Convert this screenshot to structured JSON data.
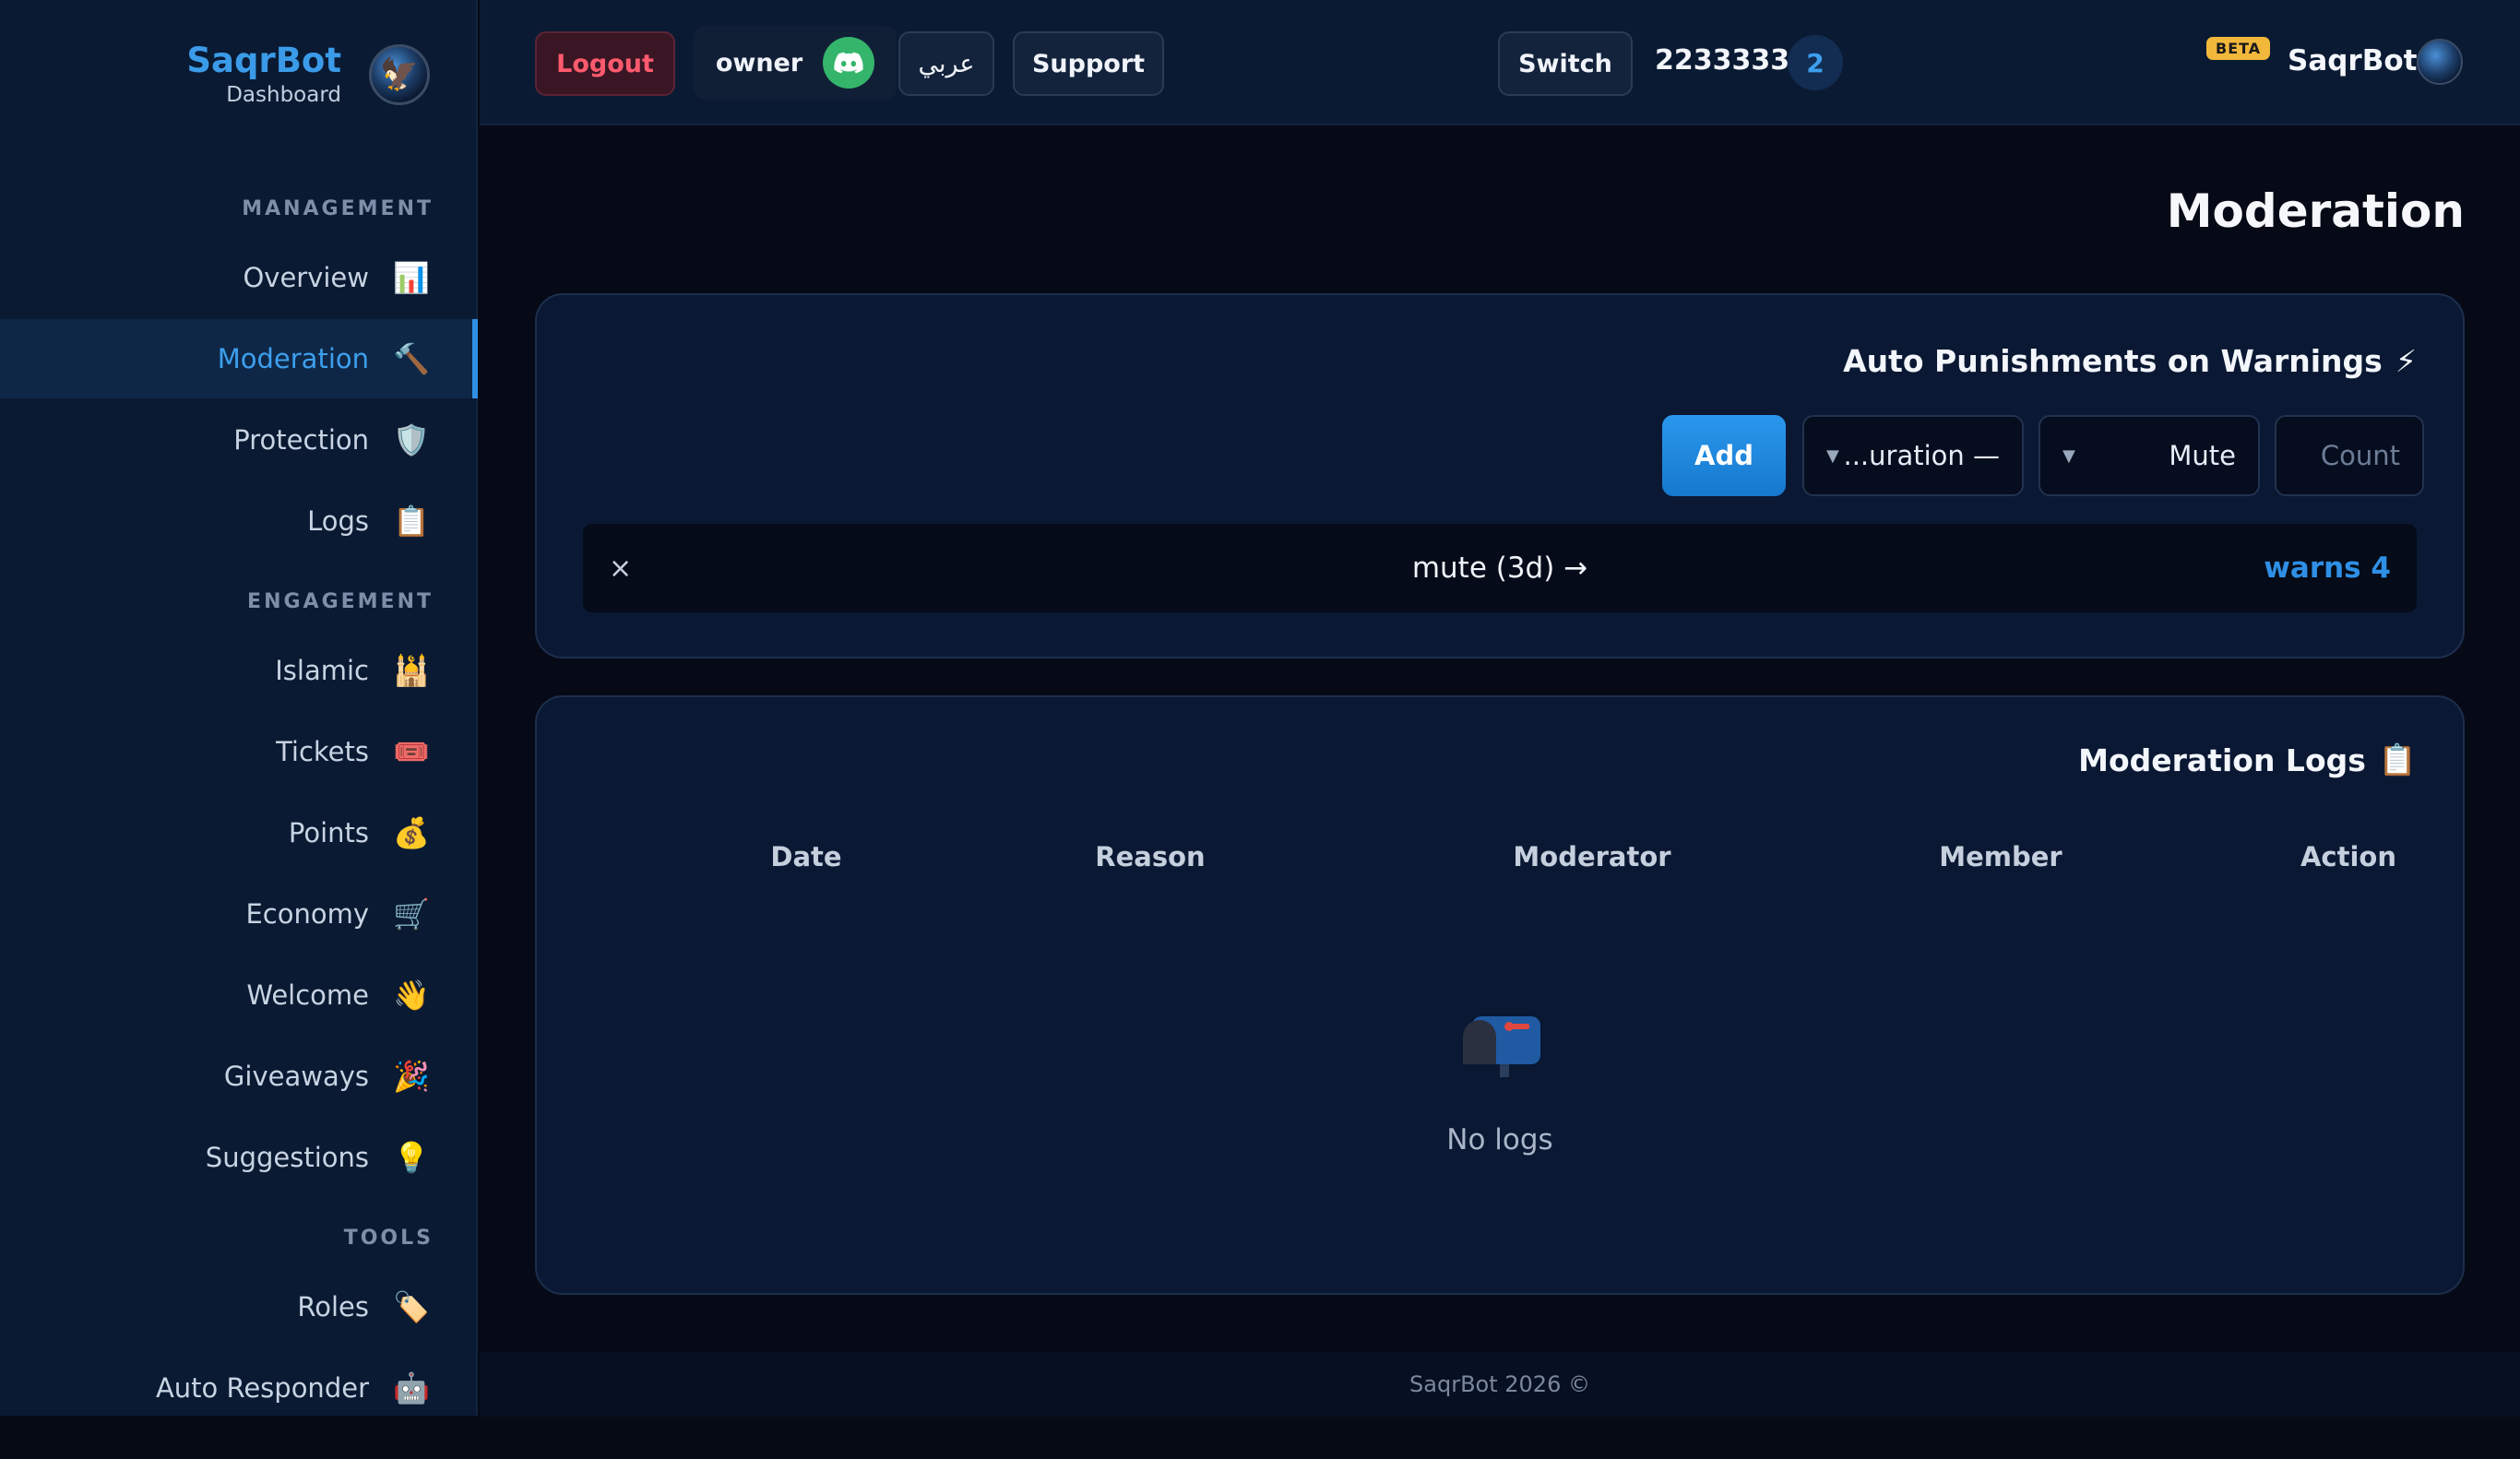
{
  "brand": {
    "title": "SaqrBot",
    "subtitle": "Dashboard"
  },
  "sidebar": {
    "sections": [
      {
        "label": "MANAGEMENT"
      },
      {
        "label": "ENGAGEMENT"
      },
      {
        "label": "TOOLS"
      }
    ],
    "items": [
      {
        "label": "Overview",
        "icon": "📊",
        "icon_name": "bar-chart-icon"
      },
      {
        "label": "Moderation",
        "icon": "🔨",
        "icon_name": "hammer-icon",
        "active": true
      },
      {
        "label": "Protection",
        "icon": "🛡️",
        "icon_name": "shield-icon"
      },
      {
        "label": "Logs",
        "icon": "📋",
        "icon_name": "clipboard-icon"
      },
      {
        "label": "Islamic",
        "icon": "🕌",
        "icon_name": "mosque-icon"
      },
      {
        "label": "Tickets",
        "icon": "🎟️",
        "icon_name": "ticket-icon"
      },
      {
        "label": "Points",
        "icon": "💰",
        "icon_name": "money-bag-icon"
      },
      {
        "label": "Economy",
        "icon": "🛒",
        "icon_name": "cart-icon"
      },
      {
        "label": "Welcome",
        "icon": "👋",
        "icon_name": "wave-icon"
      },
      {
        "label": "Giveaways",
        "icon": "🎉",
        "icon_name": "party-icon"
      },
      {
        "label": "Suggestions",
        "icon": "💡",
        "icon_name": "lightbulb-icon"
      },
      {
        "label": "Roles",
        "icon": "🏷️",
        "icon_name": "tag-icon"
      },
      {
        "label": "Auto Responder",
        "icon": "🤖",
        "icon_name": "robot-icon"
      }
    ]
  },
  "topbar": {
    "logout": "Logout",
    "owner": "owner",
    "arabic": "عربي",
    "support": "Support",
    "switch": "Switch",
    "server_id": "2233333",
    "server_count": "2",
    "beta": "BETA",
    "bot_name": "SaqrBot"
  },
  "colors": {
    "accent": "#2f8fe6",
    "danger": "#ff5a6e",
    "discord_green": "#34b56b",
    "beta": "#f2b83b"
  },
  "page": {
    "title": "Moderation"
  },
  "auto_punishments": {
    "title": "Auto Punishments on Warnings",
    "title_icon": "⚡",
    "add_label": "Add",
    "duration_value": "...uration —",
    "action_value": "Mute",
    "count_placeholder": "Count",
    "rules": [
      {
        "text": "mute (3d) →",
        "warns": "warns 4",
        "remove": "×"
      }
    ]
  },
  "moderation_logs": {
    "title": "Moderation Logs",
    "title_icon": "📋",
    "columns": [
      "Date",
      "Reason",
      "Moderator",
      "Member",
      "Action"
    ],
    "empty_text": "No logs"
  },
  "footer": {
    "text": "SaqrBot 2026 ©"
  }
}
